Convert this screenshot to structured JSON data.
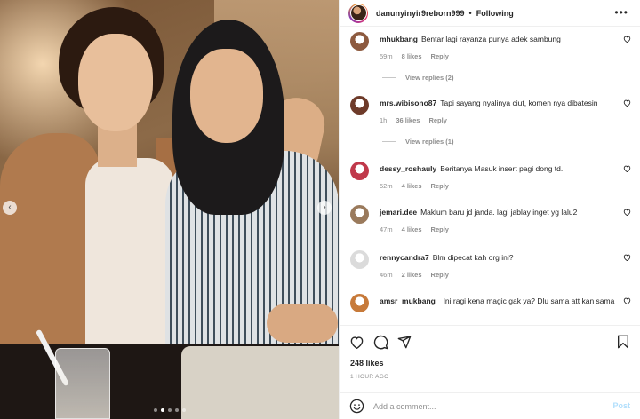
{
  "header": {
    "username": "danunyinyir9reborn999",
    "separator": "•",
    "follow_status": "Following",
    "more_icon": "more-horizontal-icon"
  },
  "photo": {
    "prev_icon": "‹",
    "next_icon": "›",
    "carousel_count": 5,
    "carousel_active_index": 1
  },
  "comments": [
    {
      "username": "mhukbang",
      "text": "Bentar lagi rayanza punya adek sambung",
      "age": "59m",
      "likes": "8 likes",
      "reply": "Reply",
      "view_replies": "View replies (2)",
      "avatar_color": "#8d5a3f"
    },
    {
      "username": "mrs.wibisono87",
      "text": "Tapi sayang nyalinya ciut, komen nya dibatesin",
      "age": "1h",
      "likes": "36 likes",
      "reply": "Reply",
      "view_replies": "View replies (1)",
      "avatar_color": "#6e3b2a"
    },
    {
      "username": "dessy_roshauly",
      "text": "Beritanya Masuk insert pagi dong td.",
      "age": "52m",
      "likes": "4 likes",
      "reply": "Reply",
      "view_replies": "",
      "avatar_color": "#c0394b"
    },
    {
      "username": "jemari.dee",
      "text": "Maklum baru jd janda. lagi jablay inget yg lalu2",
      "age": "47m",
      "likes": "4 likes",
      "reply": "Reply",
      "view_replies": "",
      "avatar_color": "#9a7a5c"
    },
    {
      "username": "rennycandra7",
      "text": "Blm dipecat kah org ini?",
      "age": "46m",
      "likes": "2 likes",
      "reply": "Reply",
      "view_replies": "",
      "avatar_color": "#dbdbdb"
    },
    {
      "username": "amsr_mukbang_",
      "text": "Ini ragi kena magic gak ya? Dlu sama att kan sama",
      "age": "",
      "likes": "",
      "reply": "",
      "view_replies": "",
      "avatar_color": "#c77a3a"
    }
  ],
  "actions": {
    "like_icon": "heart-icon",
    "comment_icon": "comment-icon",
    "share_icon": "send-icon",
    "save_icon": "bookmark-icon"
  },
  "likes_count": "248 likes",
  "timestamp": "1 HOUR AGO",
  "add_comment": {
    "placeholder": "Add a comment...",
    "post_label": "Post"
  },
  "colors": {
    "text": "#262626",
    "muted": "#8e8e8e",
    "post_disabled": "#b2dffc"
  }
}
